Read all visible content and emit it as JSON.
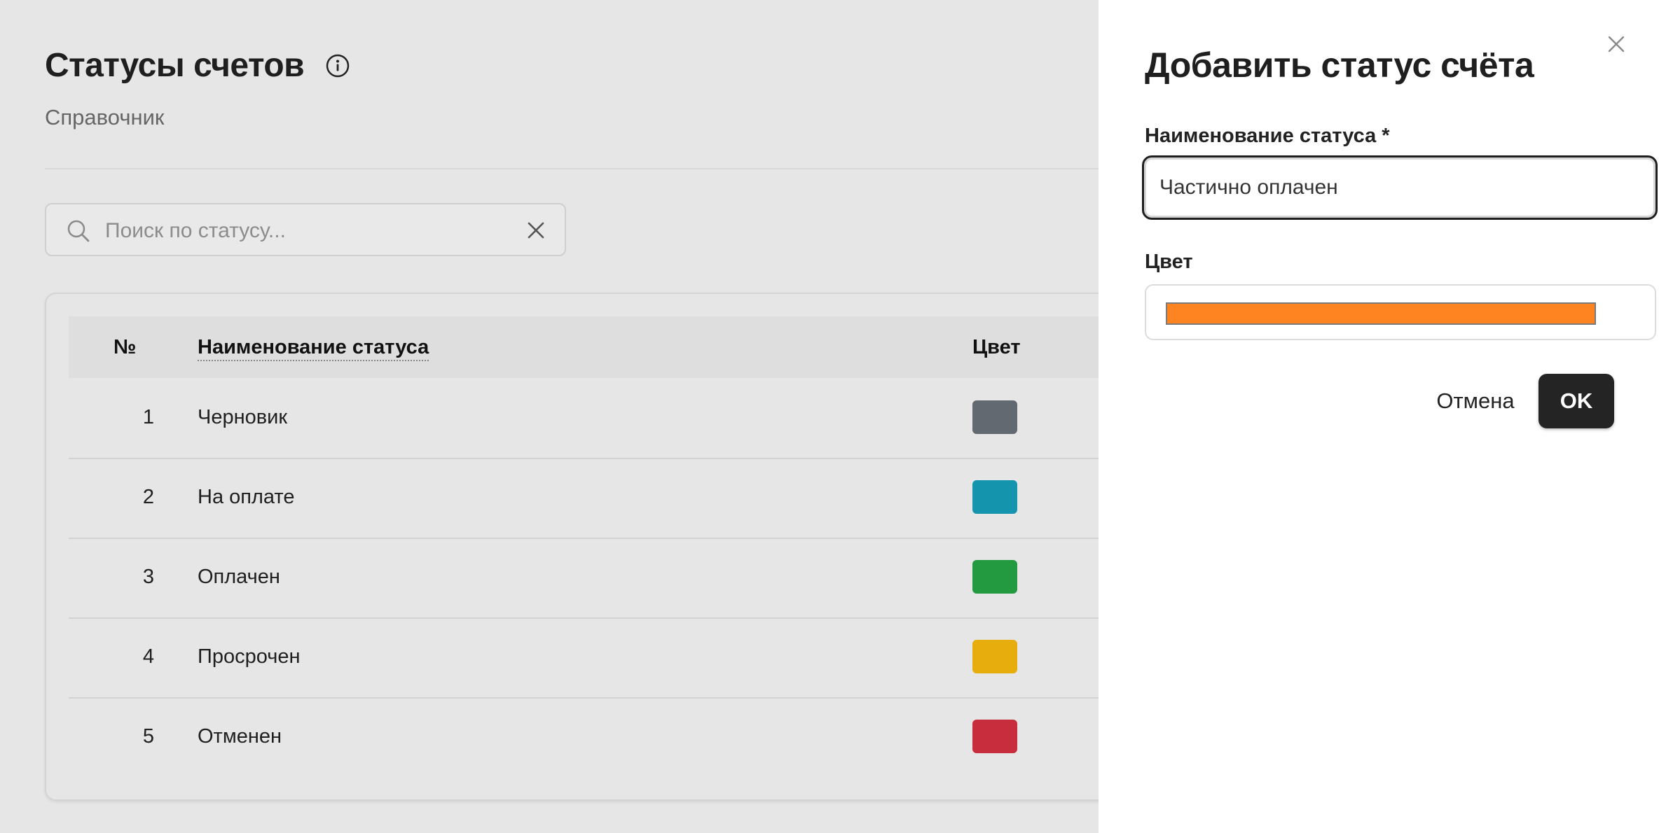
{
  "header": {
    "title": "Статусы счетов",
    "subtitle": "Справочник"
  },
  "search": {
    "placeholder": "Поиск по статусу...",
    "value": ""
  },
  "table": {
    "columns": [
      "№",
      "Наименование статуса",
      "Цвет"
    ],
    "rows": [
      {
        "num": "1",
        "name": "Черновик",
        "color": "#626970"
      },
      {
        "num": "2",
        "name": "На оплате",
        "color": "#1595ad"
      },
      {
        "num": "3",
        "name": "Оплачен",
        "color": "#239a40"
      },
      {
        "num": "4",
        "name": "Просрочен",
        "color": "#e6ad0c"
      },
      {
        "num": "5",
        "name": "Отменен",
        "color": "#c72d3c"
      }
    ]
  },
  "panel": {
    "title": "Добавить статус счёта",
    "name_label": "Наименование статуса *",
    "name_value": "Частично оплачен",
    "color_label": "Цвет",
    "color_value": "#fd8420",
    "cancel_label": "Отмена",
    "ok_label": "OK"
  },
  "icons": {
    "info": "info-icon",
    "search": "search-icon",
    "clear": "close-icon",
    "close_panel": "close-icon"
  }
}
